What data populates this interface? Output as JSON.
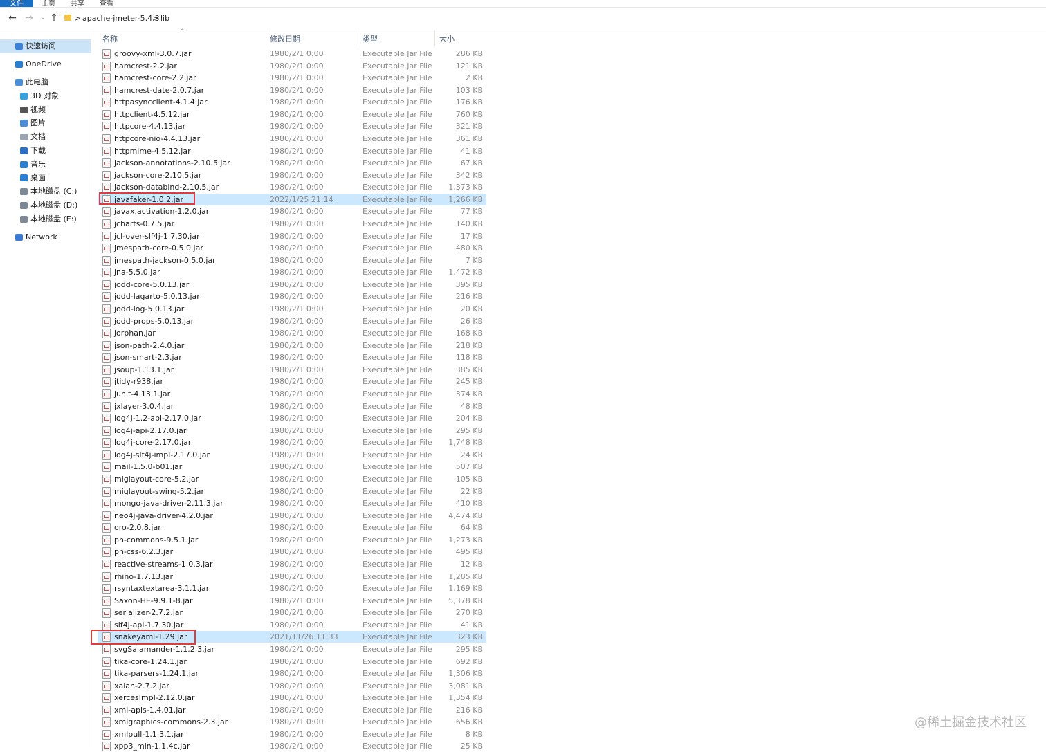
{
  "ribbon": {
    "tabs": [
      "文件",
      "主页",
      "共享",
      "查看"
    ]
  },
  "address": {
    "back": "←",
    "forward": "→",
    "recent": "⌄",
    "up": "↑",
    "sep": ">",
    "crumbs": [
      "apache-jmeter-5.4.3",
      "lib"
    ]
  },
  "sidebar": {
    "items": [
      {
        "label": "快速访问",
        "icon": "star-icon",
        "selected": true
      },
      {
        "label": "OneDrive",
        "icon": "cloud-icon"
      },
      {
        "label": "此电脑",
        "icon": "computer-icon"
      },
      {
        "label": "3D 对象",
        "icon": "cube-icon"
      },
      {
        "label": "视频",
        "icon": "video-icon"
      },
      {
        "label": "图片",
        "icon": "picture-icon"
      },
      {
        "label": "文档",
        "icon": "document-icon"
      },
      {
        "label": "下载",
        "icon": "download-icon"
      },
      {
        "label": "音乐",
        "icon": "music-icon"
      },
      {
        "label": "桌面",
        "icon": "desktop-icon"
      },
      {
        "label": "本地磁盘 (C:)",
        "icon": "drive-icon"
      },
      {
        "label": "本地磁盘 (D:)",
        "icon": "drive-icon"
      },
      {
        "label": "本地磁盘 (E:)",
        "icon": "drive-icon"
      },
      {
        "label": "Network",
        "icon": "network-icon"
      }
    ]
  },
  "columns": {
    "name": "名称",
    "date": "修改日期",
    "type": "类型",
    "size": "大小",
    "sort_caret": "^"
  },
  "files": [
    {
      "name": "groovy-xml-3.0.7.jar",
      "date": "1980/2/1 0:00",
      "type": "Executable Jar File",
      "size": "286 KB"
    },
    {
      "name": "hamcrest-2.2.jar",
      "date": "1980/2/1 0:00",
      "type": "Executable Jar File",
      "size": "121 KB"
    },
    {
      "name": "hamcrest-core-2.2.jar",
      "date": "1980/2/1 0:00",
      "type": "Executable Jar File",
      "size": "2 KB"
    },
    {
      "name": "hamcrest-date-2.0.7.jar",
      "date": "1980/2/1 0:00",
      "type": "Executable Jar File",
      "size": "103 KB"
    },
    {
      "name": "httpasyncclient-4.1.4.jar",
      "date": "1980/2/1 0:00",
      "type": "Executable Jar File",
      "size": "176 KB"
    },
    {
      "name": "httpclient-4.5.12.jar",
      "date": "1980/2/1 0:00",
      "type": "Executable Jar File",
      "size": "760 KB"
    },
    {
      "name": "httpcore-4.4.13.jar",
      "date": "1980/2/1 0:00",
      "type": "Executable Jar File",
      "size": "321 KB"
    },
    {
      "name": "httpcore-nio-4.4.13.jar",
      "date": "1980/2/1 0:00",
      "type": "Executable Jar File",
      "size": "361 KB"
    },
    {
      "name": "httpmime-4.5.12.jar",
      "date": "1980/2/1 0:00",
      "type": "Executable Jar File",
      "size": "41 KB"
    },
    {
      "name": "jackson-annotations-2.10.5.jar",
      "date": "1980/2/1 0:00",
      "type": "Executable Jar File",
      "size": "67 KB"
    },
    {
      "name": "jackson-core-2.10.5.jar",
      "date": "1980/2/1 0:00",
      "type": "Executable Jar File",
      "size": "342 KB"
    },
    {
      "name": "jackson-databind-2.10.5.jar",
      "date": "1980/2/1 0:00",
      "type": "Executable Jar File",
      "size": "1,373 KB"
    },
    {
      "name": "javafaker-1.0.2.jar",
      "date": "2022/1/25 21:14",
      "type": "Executable Jar File",
      "size": "1,266 KB",
      "selected": true
    },
    {
      "name": "javax.activation-1.2.0.jar",
      "date": "1980/2/1 0:00",
      "type": "Executable Jar File",
      "size": "77 KB"
    },
    {
      "name": "jcharts-0.7.5.jar",
      "date": "1980/2/1 0:00",
      "type": "Executable Jar File",
      "size": "140 KB"
    },
    {
      "name": "jcl-over-slf4j-1.7.30.jar",
      "date": "1980/2/1 0:00",
      "type": "Executable Jar File",
      "size": "17 KB"
    },
    {
      "name": "jmespath-core-0.5.0.jar",
      "date": "1980/2/1 0:00",
      "type": "Executable Jar File",
      "size": "480 KB"
    },
    {
      "name": "jmespath-jackson-0.5.0.jar",
      "date": "1980/2/1 0:00",
      "type": "Executable Jar File",
      "size": "7 KB"
    },
    {
      "name": "jna-5.5.0.jar",
      "date": "1980/2/1 0:00",
      "type": "Executable Jar File",
      "size": "1,472 KB"
    },
    {
      "name": "jodd-core-5.0.13.jar",
      "date": "1980/2/1 0:00",
      "type": "Executable Jar File",
      "size": "395 KB"
    },
    {
      "name": "jodd-lagarto-5.0.13.jar",
      "date": "1980/2/1 0:00",
      "type": "Executable Jar File",
      "size": "216 KB"
    },
    {
      "name": "jodd-log-5.0.13.jar",
      "date": "1980/2/1 0:00",
      "type": "Executable Jar File",
      "size": "20 KB"
    },
    {
      "name": "jodd-props-5.0.13.jar",
      "date": "1980/2/1 0:00",
      "type": "Executable Jar File",
      "size": "26 KB"
    },
    {
      "name": "jorphan.jar",
      "date": "1980/2/1 0:00",
      "type": "Executable Jar File",
      "size": "168 KB"
    },
    {
      "name": "json-path-2.4.0.jar",
      "date": "1980/2/1 0:00",
      "type": "Executable Jar File",
      "size": "218 KB"
    },
    {
      "name": "json-smart-2.3.jar",
      "date": "1980/2/1 0:00",
      "type": "Executable Jar File",
      "size": "118 KB"
    },
    {
      "name": "jsoup-1.13.1.jar",
      "date": "1980/2/1 0:00",
      "type": "Executable Jar File",
      "size": "385 KB"
    },
    {
      "name": "jtidy-r938.jar",
      "date": "1980/2/1 0:00",
      "type": "Executable Jar File",
      "size": "245 KB"
    },
    {
      "name": "junit-4.13.1.jar",
      "date": "1980/2/1 0:00",
      "type": "Executable Jar File",
      "size": "374 KB"
    },
    {
      "name": "jxlayer-3.0.4.jar",
      "date": "1980/2/1 0:00",
      "type": "Executable Jar File",
      "size": "48 KB"
    },
    {
      "name": "log4j-1.2-api-2.17.0.jar",
      "date": "1980/2/1 0:00",
      "type": "Executable Jar File",
      "size": "204 KB"
    },
    {
      "name": "log4j-api-2.17.0.jar",
      "date": "1980/2/1 0:00",
      "type": "Executable Jar File",
      "size": "295 KB"
    },
    {
      "name": "log4j-core-2.17.0.jar",
      "date": "1980/2/1 0:00",
      "type": "Executable Jar File",
      "size": "1,748 KB"
    },
    {
      "name": "log4j-slf4j-impl-2.17.0.jar",
      "date": "1980/2/1 0:00",
      "type": "Executable Jar File",
      "size": "24 KB"
    },
    {
      "name": "mail-1.5.0-b01.jar",
      "date": "1980/2/1 0:00",
      "type": "Executable Jar File",
      "size": "507 KB"
    },
    {
      "name": "miglayout-core-5.2.jar",
      "date": "1980/2/1 0:00",
      "type": "Executable Jar File",
      "size": "105 KB"
    },
    {
      "name": "miglayout-swing-5.2.jar",
      "date": "1980/2/1 0:00",
      "type": "Executable Jar File",
      "size": "22 KB"
    },
    {
      "name": "mongo-java-driver-2.11.3.jar",
      "date": "1980/2/1 0:00",
      "type": "Executable Jar File",
      "size": "410 KB"
    },
    {
      "name": "neo4j-java-driver-4.2.0.jar",
      "date": "1980/2/1 0:00",
      "type": "Executable Jar File",
      "size": "4,474 KB"
    },
    {
      "name": "oro-2.0.8.jar",
      "date": "1980/2/1 0:00",
      "type": "Executable Jar File",
      "size": "64 KB"
    },
    {
      "name": "ph-commons-9.5.1.jar",
      "date": "1980/2/1 0:00",
      "type": "Executable Jar File",
      "size": "1,273 KB"
    },
    {
      "name": "ph-css-6.2.3.jar",
      "date": "1980/2/1 0:00",
      "type": "Executable Jar File",
      "size": "495 KB"
    },
    {
      "name": "reactive-streams-1.0.3.jar",
      "date": "1980/2/1 0:00",
      "type": "Executable Jar File",
      "size": "12 KB"
    },
    {
      "name": "rhino-1.7.13.jar",
      "date": "1980/2/1 0:00",
      "type": "Executable Jar File",
      "size": "1,285 KB"
    },
    {
      "name": "rsyntaxtextarea-3.1.1.jar",
      "date": "1980/2/1 0:00",
      "type": "Executable Jar File",
      "size": "1,169 KB"
    },
    {
      "name": "Saxon-HE-9.9.1-8.jar",
      "date": "1980/2/1 0:00",
      "type": "Executable Jar File",
      "size": "5,378 KB"
    },
    {
      "name": "serializer-2.7.2.jar",
      "date": "1980/2/1 0:00",
      "type": "Executable Jar File",
      "size": "270 KB"
    },
    {
      "name": "slf4j-api-1.7.30.jar",
      "date": "1980/2/1 0:00",
      "type": "Executable Jar File",
      "size": "41 KB"
    },
    {
      "name": "snakeyaml-1.29.jar",
      "date": "2021/11/26 11:33",
      "type": "Executable Jar File",
      "size": "323 KB",
      "selected": true
    },
    {
      "name": "svgSalamander-1.1.2.3.jar",
      "date": "1980/2/1 0:00",
      "type": "Executable Jar File",
      "size": "295 KB"
    },
    {
      "name": "tika-core-1.24.1.jar",
      "date": "1980/2/1 0:00",
      "type": "Executable Jar File",
      "size": "692 KB"
    },
    {
      "name": "tika-parsers-1.24.1.jar",
      "date": "1980/2/1 0:00",
      "type": "Executable Jar File",
      "size": "1,306 KB"
    },
    {
      "name": "xalan-2.7.2.jar",
      "date": "1980/2/1 0:00",
      "type": "Executable Jar File",
      "size": "3,081 KB"
    },
    {
      "name": "xercesImpl-2.12.0.jar",
      "date": "1980/2/1 0:00",
      "type": "Executable Jar File",
      "size": "1,354 KB"
    },
    {
      "name": "xml-apis-1.4.01.jar",
      "date": "1980/2/1 0:00",
      "type": "Executable Jar File",
      "size": "216 KB"
    },
    {
      "name": "xmlgraphics-commons-2.3.jar",
      "date": "1980/2/1 0:00",
      "type": "Executable Jar File",
      "size": "656 KB"
    },
    {
      "name": "xmlpull-1.1.3.1.jar",
      "date": "1980/2/1 0:00",
      "type": "Executable Jar File",
      "size": "8 KB"
    },
    {
      "name": "xpp3_min-1.1.4c.jar",
      "date": "1980/2/1 0:00",
      "type": "Executable Jar File",
      "size": "25 KB"
    }
  ],
  "watermark": "@稀土掘金技术社区",
  "colors": {
    "selection": "#cce8ff",
    "highlight_box": "#e03a3a",
    "file_tab": "#1a6fc4"
  }
}
